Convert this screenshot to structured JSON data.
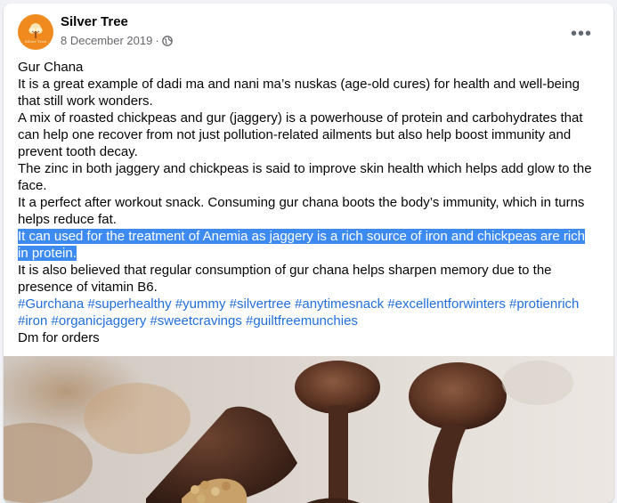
{
  "post": {
    "page_name": "Silver Tree",
    "date": "8 December 2019",
    "separator": "·",
    "avatar_text": "Silver Tree",
    "more_icon": "•••",
    "paragraphs": [
      "Gur Chana",
      "It is a great example of dadi ma and nani ma’s nuskas (age-old cures) for health and well-being that still work wonders.",
      "A mix of roasted chickpeas and gur (jaggery) is a powerhouse of protein and carbohydrates that can help one recover from not just pollution-related ailments but also help boost immunity and prevent tooth decay.",
      "The zinc in both jaggery and chickpeas is said to improve skin health which helps add glow to the face.",
      "It a perfect after workout snack. Consuming gur chana boots the body’s immunity, which in turns helps reduce fat."
    ],
    "highlighted": "It can used for the treatment of Anemia as jaggery is a rich source of iron and chickpeas are rich in protein.",
    "after": "It is also believed that regular consumption of gur chana helps sharpen memory due to the presence of vitamin B6.",
    "hashtags": [
      "#Gurchana",
      "#superhealthy",
      "#yummy",
      "#silvertree",
      "#anytimesnack",
      "#excellentforwinters",
      "#protienrich",
      "#iron",
      "#organicjaggery",
      "#sweetcravings",
      "#guiltfreemunchies"
    ],
    "footer": "Dm for orders"
  },
  "colors": {
    "link": "#216fdb",
    "highlight": "#3d8bf1",
    "avatar": "#f08a1e"
  },
  "icons": {
    "privacy": "globe-icon",
    "menu": "more-options-icon"
  }
}
